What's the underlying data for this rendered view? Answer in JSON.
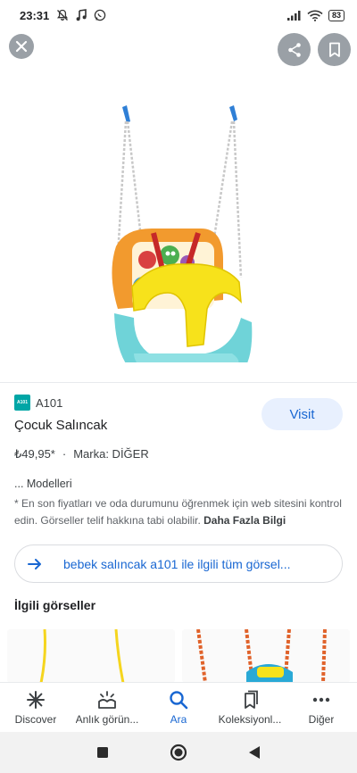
{
  "status_bar": {
    "time": "23:31",
    "battery": "83"
  },
  "product": {
    "source": "A101",
    "source_logo_text": "A101",
    "title": "Çocuk Salıncak",
    "visit_label": "Visit",
    "price": "₺49,95*",
    "separator": "·",
    "brand": "Marka: DİĞER",
    "models": "... Modelleri",
    "disclaimer": "* En son fiyatları ve oda durumunu öğrenmek için web sitesini kontrol edin. Görseller telif hakkına tabi olabilir.",
    "more_info": "Daha Fazla Bilgi"
  },
  "related_search": {
    "label": "bebek salıncak a101 ile ilgili tüm görsel..."
  },
  "related_images": {
    "title": "İlgili görseller"
  },
  "bottom_nav": {
    "items": [
      {
        "label": "Discover",
        "icon": "asterisk-icon"
      },
      {
        "label": "Anlık görün...",
        "icon": "snapshot-icon"
      },
      {
        "label": "Ara",
        "icon": "search-icon"
      },
      {
        "label": "Koleksiyonl...",
        "icon": "collections-icon"
      },
      {
        "label": "Diğer",
        "icon": "more-icon"
      }
    ],
    "active_index": 2,
    "active_color": "#1967d2"
  }
}
